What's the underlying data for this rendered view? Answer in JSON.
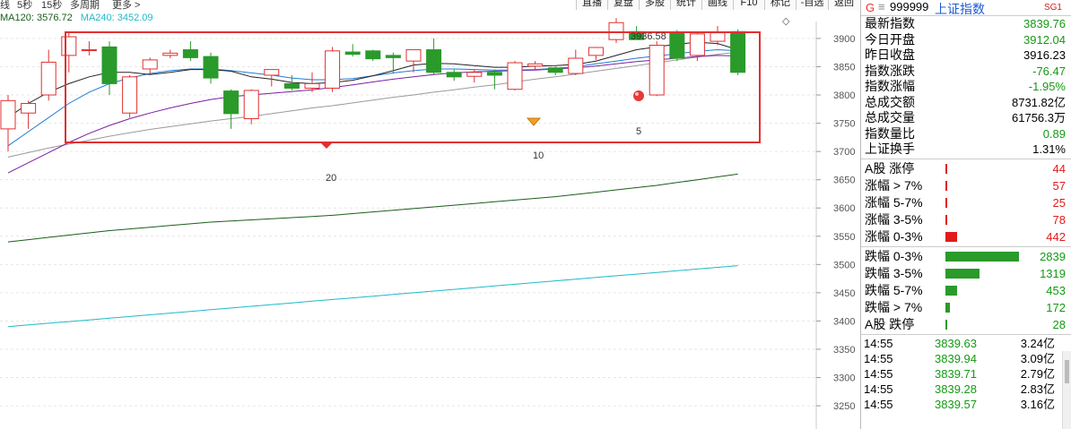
{
  "toolbar": {
    "period_left": "线",
    "periods": [
      "5秒",
      "15秒",
      "多周期",
      "更多 >"
    ],
    "buttons": [
      "直播",
      "复盘",
      "多股",
      "统计",
      "画线",
      "F10",
      "标记",
      "-自选",
      "返回"
    ]
  },
  "legend": {
    "ma120": "MA120: 3576.72",
    "ma240": "MA240: 3452.09",
    "colors": {
      "ma120": "#1b5e1b",
      "ma240": "#1fb9c9"
    }
  },
  "chart": {
    "y_ticks": [
      "3900",
      "3850",
      "3800",
      "3750",
      "3700",
      "3650",
      "3600",
      "3550",
      "3500",
      "3450",
      "3400",
      "3350",
      "3300",
      "3250"
    ],
    "high_label": "3936.58",
    "count_labels": [
      "20",
      "10",
      "5"
    ],
    "highlight_color": "#e23030",
    "up_color": "#e23030",
    "down_color": "#2a9a2a"
  },
  "chart_data": {
    "type": "candlestick",
    "ylim": [
      3220,
      3930
    ],
    "candles": [
      {
        "o": 3740,
        "h": 3800,
        "l": 3700,
        "c": 3790
      },
      {
        "o": 3768,
        "h": 3790,
        "l": 3740,
        "c": 3785
      },
      {
        "o": 3800,
        "h": 3880,
        "l": 3790,
        "c": 3858
      },
      {
        "o": 3870,
        "h": 3910,
        "l": 3840,
        "c": 3903
      },
      {
        "o": 3880,
        "h": 3895,
        "l": 3870,
        "c": 3880
      },
      {
        "o": 3885,
        "h": 3895,
        "l": 3800,
        "c": 3820
      },
      {
        "o": 3768,
        "h": 3835,
        "l": 3760,
        "c": 3832
      },
      {
        "o": 3846,
        "h": 3866,
        "l": 3838,
        "c": 3862
      },
      {
        "o": 3870,
        "h": 3880,
        "l": 3865,
        "c": 3874
      },
      {
        "o": 3880,
        "h": 3895,
        "l": 3860,
        "c": 3866
      },
      {
        "o": 3868,
        "h": 3875,
        "l": 3820,
        "c": 3830
      },
      {
        "o": 3807,
        "h": 3810,
        "l": 3740,
        "c": 3767
      },
      {
        "o": 3758,
        "h": 3810,
        "l": 3748,
        "c": 3808
      },
      {
        "o": 3835,
        "h": 3845,
        "l": 3815,
        "c": 3845
      },
      {
        "o": 3820,
        "h": 3835,
        "l": 3808,
        "c": 3812
      },
      {
        "o": 3812,
        "h": 3840,
        "l": 3805,
        "c": 3820
      },
      {
        "o": 3812,
        "h": 3885,
        "l": 3805,
        "c": 3878
      },
      {
        "o": 3876,
        "h": 3890,
        "l": 3868,
        "c": 3872
      },
      {
        "o": 3878,
        "h": 3880,
        "l": 3860,
        "c": 3864
      },
      {
        "o": 3870,
        "h": 3875,
        "l": 3838,
        "c": 3866
      },
      {
        "o": 3860,
        "h": 3880,
        "l": 3840,
        "c": 3880
      },
      {
        "o": 3880,
        "h": 3900,
        "l": 3835,
        "c": 3840
      },
      {
        "o": 3840,
        "h": 3845,
        "l": 3825,
        "c": 3832
      },
      {
        "o": 3833,
        "h": 3845,
        "l": 3822,
        "c": 3840
      },
      {
        "o": 3840,
        "h": 3845,
        "l": 3810,
        "c": 3835
      },
      {
        "o": 3810,
        "h": 3860,
        "l": 3808,
        "c": 3857
      },
      {
        "o": 3851,
        "h": 3860,
        "l": 3845,
        "c": 3855
      },
      {
        "o": 3848,
        "h": 3850,
        "l": 3835,
        "c": 3840
      },
      {
        "o": 3838,
        "h": 3880,
        "l": 3835,
        "c": 3865
      },
      {
        "o": 3870,
        "h": 3885,
        "l": 3862,
        "c": 3884
      },
      {
        "o": 3898,
        "h": 3936,
        "l": 3892,
        "c": 3928
      },
      {
        "o": 3912,
        "h": 3922,
        "l": 3898,
        "c": 3898
      },
      {
        "o": 3800,
        "h": 3895,
        "l": 3798,
        "c": 3888
      },
      {
        "o": 3910,
        "h": 3915,
        "l": 3860,
        "c": 3865
      },
      {
        "o": 3870,
        "h": 3912,
        "l": 3860,
        "c": 3908
      },
      {
        "o": 3895,
        "h": 3922,
        "l": 3888,
        "c": 3910
      },
      {
        "o": 3912,
        "h": 3916,
        "l": 3835,
        "c": 3840
      }
    ],
    "ma_black": [
      3760,
      3785,
      3805,
      3820,
      3832,
      3840,
      3840,
      3836,
      3840,
      3845,
      3845,
      3842,
      3832,
      3828,
      3822,
      3820,
      3822,
      3826,
      3834,
      3843,
      3853,
      3856,
      3855,
      3852,
      3849,
      3849,
      3851,
      3852,
      3854,
      3860,
      3870,
      3880,
      3885,
      3890,
      3893,
      3891,
      3880
    ],
    "ma_blue": [
      3710,
      3735,
      3760,
      3785,
      3805,
      3820,
      3830,
      3838,
      3843,
      3846,
      3846,
      3843,
      3839,
      3835,
      3830,
      3827,
      3827,
      3829,
      3834,
      3839,
      3843,
      3846,
      3846,
      3845,
      3844,
      3844,
      3845,
      3847,
      3850,
      3855,
      3860,
      3865,
      3869,
      3873,
      3877,
      3880,
      3878
    ],
    "ma_purple": [
      3662,
      3680,
      3698,
      3716,
      3732,
      3746,
      3758,
      3768,
      3777,
      3785,
      3792,
      3797,
      3800,
      3803,
      3806,
      3809,
      3813,
      3818,
      3823,
      3828,
      3832,
      3836,
      3839,
      3841,
      3842,
      3843,
      3844,
      3846,
      3848,
      3851,
      3855,
      3859,
      3862,
      3865,
      3868,
      3870,
      3869
    ],
    "ma_gray": [
      3690,
      3698,
      3706,
      3713,
      3720,
      3727,
      3733,
      3739,
      3744,
      3749,
      3754,
      3758,
      3762,
      3767,
      3772,
      3777,
      3781,
      3786,
      3791,
      3796,
      3800,
      3805,
      3809,
      3814,
      3818,
      3823,
      3828,
      3832,
      3837,
      3842,
      3847,
      3852,
      3857,
      3862,
      3867,
      3872,
      3876
    ],
    "ma120": [
      3540,
      3544,
      3548,
      3552,
      3556,
      3560,
      3563,
      3566,
      3569,
      3572,
      3575,
      3577,
      3579,
      3581,
      3583,
      3585,
      3587,
      3590,
      3593,
      3596,
      3599,
      3602,
      3605,
      3608,
      3611,
      3614,
      3617,
      3620,
      3624,
      3628,
      3632,
      3636,
      3640,
      3645,
      3650,
      3655,
      3660
    ],
    "ma240": [
      3390,
      3393,
      3396,
      3399,
      3402,
      3405,
      3408,
      3411,
      3414,
      3417,
      3420,
      3423,
      3426,
      3429,
      3432,
      3435,
      3438,
      3441,
      3444,
      3447,
      3450,
      3453,
      3456,
      3459,
      3462,
      3465,
      3468,
      3471,
      3474,
      3477,
      3480,
      3483,
      3486,
      3489,
      3492,
      3495,
      3498
    ]
  },
  "panel": {
    "header": {
      "g": "G",
      "eq": "≡",
      "code": "999999",
      "name": "上证指数",
      "sg": "SG1"
    },
    "quotes": [
      {
        "label": "最新指数",
        "value": "3839.76",
        "color": "green"
      },
      {
        "label": "今日开盘",
        "value": "3912.04",
        "color": "green"
      },
      {
        "label": "昨日收盘",
        "value": "3916.23",
        "color": "black"
      },
      {
        "label": "指数涨跌",
        "value": "-76.47",
        "color": "green"
      },
      {
        "label": "指数涨幅",
        "value": "-1.95%",
        "color": "green"
      },
      {
        "label": "总成交额",
        "value": "8731.82亿",
        "color": "black"
      },
      {
        "label": "总成交量",
        "value": "61756.3万",
        "color": "black"
      },
      {
        "label": "指数量比",
        "value": "0.89",
        "color": "green"
      },
      {
        "label": "上证换手",
        "value": "1.31%",
        "color": "black"
      }
    ],
    "breadth": [
      {
        "label": "A股 涨停",
        "value": "44",
        "fraction": 0.016,
        "color": "#e21b1b"
      },
      {
        "label": "涨幅 > 7%",
        "value": "57",
        "fraction": 0.02,
        "color": "#e21b1b"
      },
      {
        "label": "涨幅 5-7%",
        "value": "25",
        "fraction": 0.01,
        "color": "#e21b1b"
      },
      {
        "label": "涨幅 3-5%",
        "value": "78",
        "fraction": 0.028,
        "color": "#e21b1b"
      },
      {
        "label": "涨幅 0-3%",
        "value": "442",
        "fraction": 0.158,
        "color": "#e21b1b"
      },
      {
        "label": "跌幅 0-3%",
        "value": "2839",
        "fraction": 1.0,
        "color": "#2a9a2a"
      },
      {
        "label": "跌幅 3-5%",
        "value": "1319",
        "fraction": 0.465,
        "color": "#2a9a2a"
      },
      {
        "label": "跌幅 5-7%",
        "value": "453",
        "fraction": 0.16,
        "color": "#2a9a2a"
      },
      {
        "label": "跌幅 > 7%",
        "value": "172",
        "fraction": 0.061,
        "color": "#2a9a2a"
      },
      {
        "label": "A股 跌停",
        "value": "28",
        "fraction": 0.01,
        "color": "#2a9a2a"
      }
    ],
    "ticks": [
      {
        "time": "14:55",
        "price": "3839.63",
        "amount": "3.24亿"
      },
      {
        "time": "14:55",
        "price": "3839.94",
        "amount": "3.09亿"
      },
      {
        "time": "14:55",
        "price": "3839.71",
        "amount": "2.79亿"
      },
      {
        "time": "14:55",
        "price": "3839.28",
        "amount": "2.83亿"
      },
      {
        "time": "14:55",
        "price": "3839.57",
        "amount": "3.16亿"
      }
    ]
  }
}
